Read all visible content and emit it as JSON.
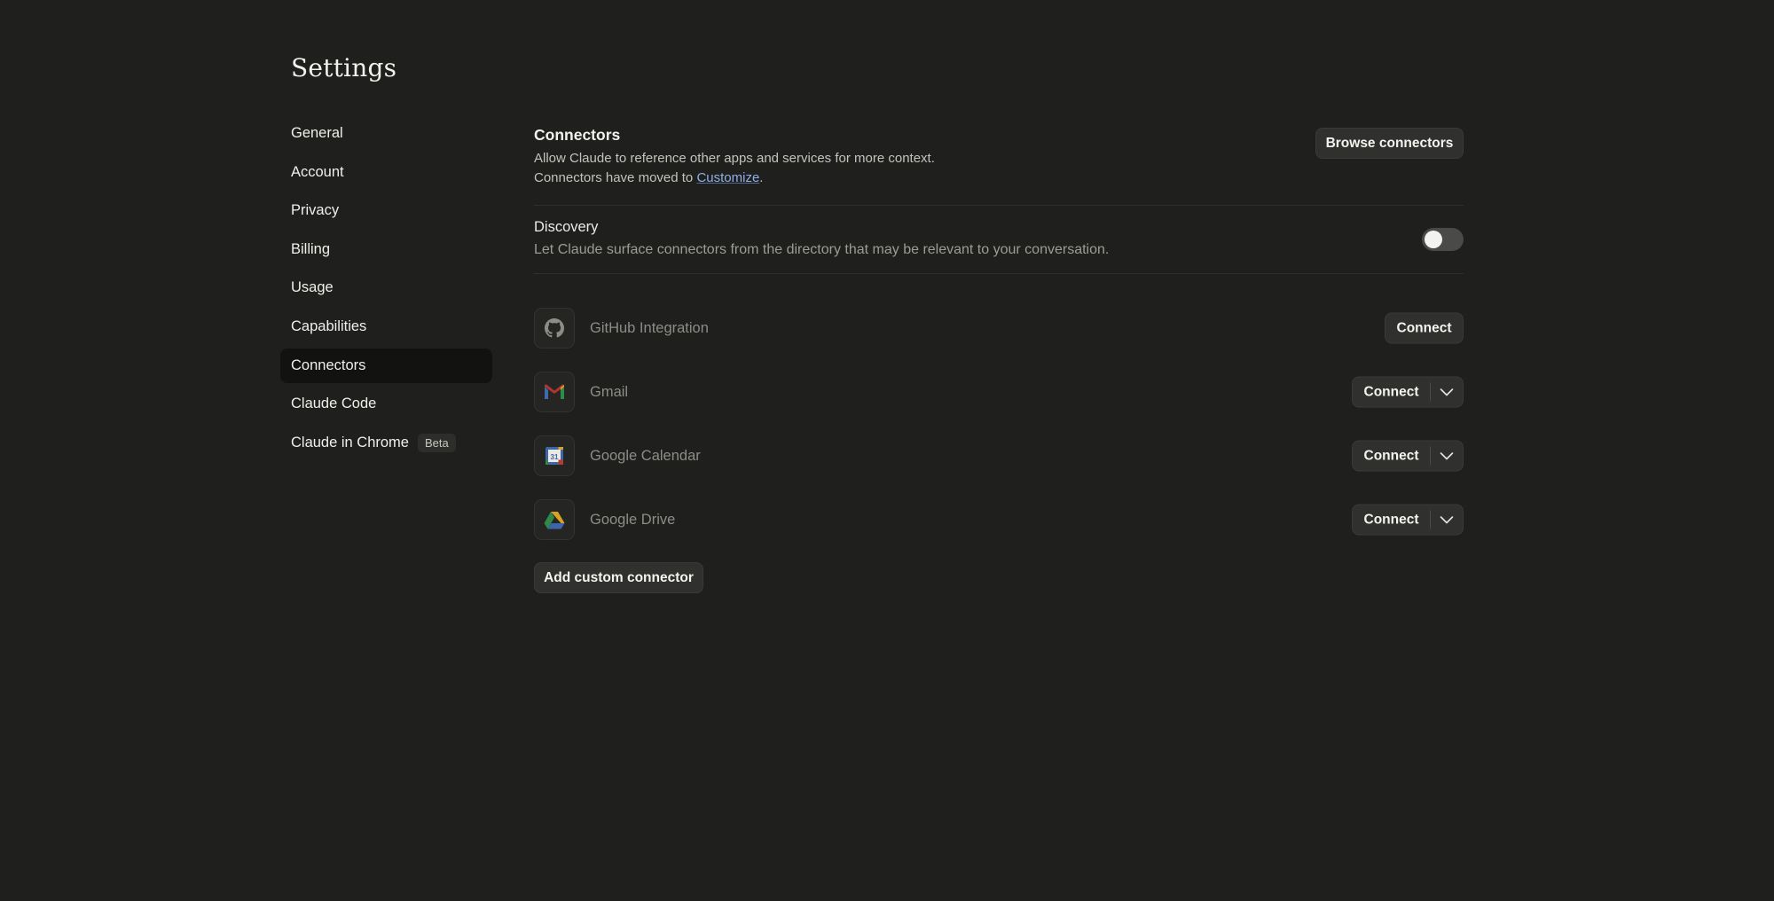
{
  "page": {
    "title": "Settings"
  },
  "sidebar": {
    "items": [
      {
        "label": "General"
      },
      {
        "label": "Account"
      },
      {
        "label": "Privacy"
      },
      {
        "label": "Billing"
      },
      {
        "label": "Usage"
      },
      {
        "label": "Capabilities"
      },
      {
        "label": "Connectors",
        "active": true
      },
      {
        "label": "Claude Code"
      },
      {
        "label": "Claude in Chrome",
        "badge": "Beta"
      }
    ]
  },
  "connectors": {
    "title": "Connectors",
    "description": "Allow Claude to reference other apps and services for more context.",
    "moved_prefix": "Connectors have moved to ",
    "moved_link": "Customize",
    "moved_suffix": ".",
    "browse_label": "Browse connectors"
  },
  "discovery": {
    "title": "Discovery",
    "description": "Let Claude surface connectors from the directory that may be relevant to your conversation.",
    "enabled": false
  },
  "connector_list": [
    {
      "name": "GitHub Integration",
      "icon": "github-icon",
      "action": "Connect",
      "has_dropdown": false
    },
    {
      "name": "Gmail",
      "icon": "gmail-icon",
      "action": "Connect",
      "has_dropdown": true
    },
    {
      "name": "Google Calendar",
      "icon": "google-calendar-icon",
      "action": "Connect",
      "has_dropdown": true
    },
    {
      "name": "Google Drive",
      "icon": "google-drive-icon",
      "action": "Connect",
      "has_dropdown": true
    }
  ],
  "add_custom_label": "Add custom connector",
  "colors": {
    "background": "#1f1f1e",
    "active_nav": "#121211",
    "button_bg": "#30302e",
    "link": "#8fb0e6"
  }
}
